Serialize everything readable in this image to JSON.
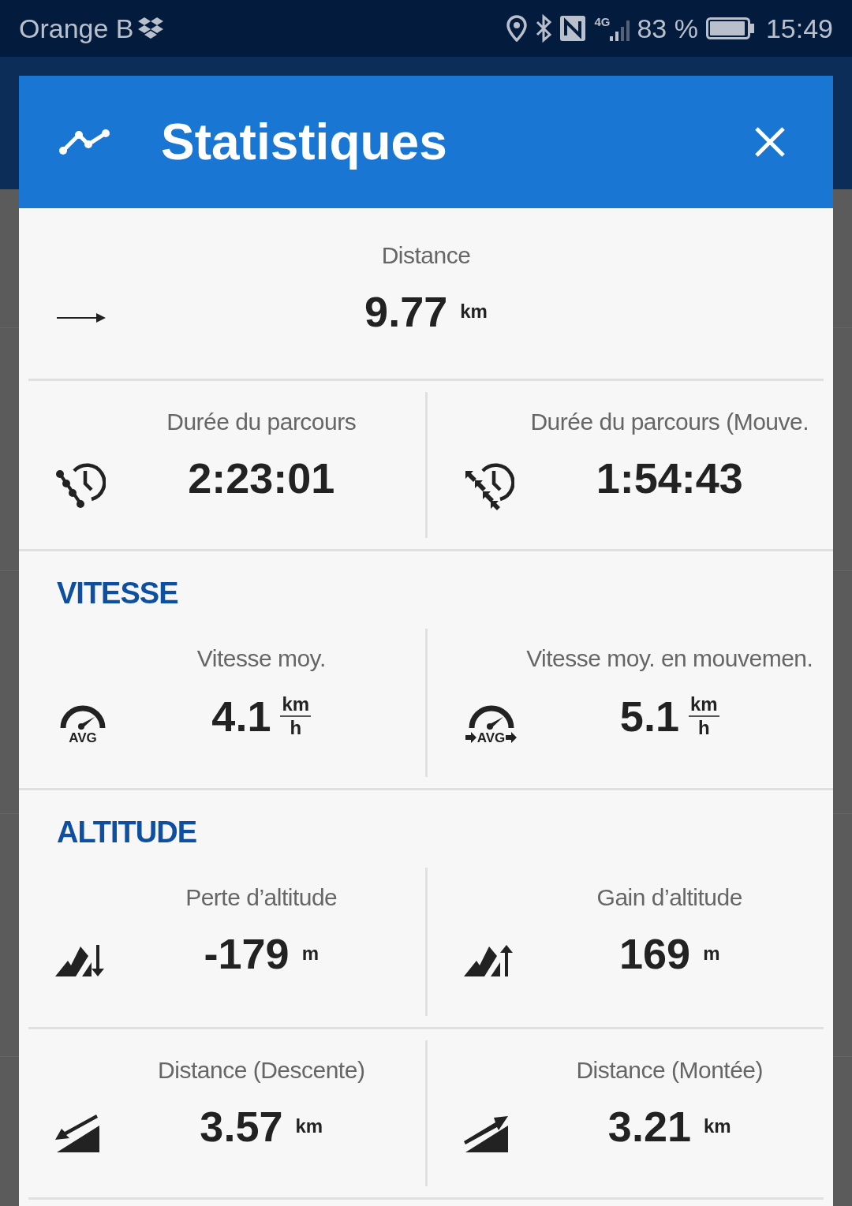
{
  "status_bar": {
    "carrier": "Orange B",
    "network": "4G",
    "battery": "83 %",
    "time": "15:49"
  },
  "dialog": {
    "title": "Statistiques",
    "sections": [
      {
        "rows": [
          {
            "cells": [
              {
                "kind": "distance",
                "label": "Distance",
                "value": "9.77",
                "unit": "km"
              }
            ]
          },
          {
            "cells": [
              {
                "kind": "duration",
                "label": "Durée du parcours",
                "value": "2:23:01"
              },
              {
                "kind": "moving_duration",
                "label": "Durée du parcours (Mouve.",
                "value": "1:54:43"
              }
            ]
          }
        ]
      },
      {
        "heading": "VITESSE",
        "rows": [
          {
            "cells": [
              {
                "kind": "avg_speed",
                "icon_text": "AVG",
                "label": "Vitesse moy.",
                "value": "4.1",
                "unit_numerator": "km",
                "unit_denominator": "h"
              },
              {
                "kind": "moving_avg_speed",
                "icon_text": "AVG",
                "label": "Vitesse moy. en mouvemen.",
                "value": "5.1",
                "unit_numerator": "km",
                "unit_denominator": "h"
              }
            ]
          }
        ]
      },
      {
        "heading": "ALTITUDE",
        "rows": [
          {
            "cells": [
              {
                "kind": "descent",
                "label": "Perte d’altitude",
                "value": "-179",
                "unit": "m"
              },
              {
                "kind": "ascent",
                "label": "Gain d’altitude",
                "value": "169",
                "unit": "m"
              }
            ]
          },
          {
            "cells": [
              {
                "kind": "distance_descent",
                "label": "Distance (Descente)",
                "value": "3.57",
                "unit": "km"
              },
              {
                "kind": "distance_ascent",
                "label": "Distance (Montée)",
                "value": "3.21",
                "unit": "km"
              }
            ]
          }
        ]
      }
    ]
  }
}
